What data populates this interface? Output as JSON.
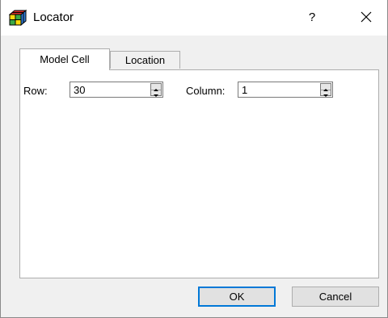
{
  "window": {
    "title": "Locator",
    "help_label": "?",
    "icons": {
      "app": "cube-app-icon",
      "close": "close-icon"
    }
  },
  "tabs": [
    {
      "label": "Model Cell",
      "selected": true
    },
    {
      "label": "Location",
      "selected": false
    }
  ],
  "fields": {
    "row": {
      "label": "Row:",
      "value": "30"
    },
    "column": {
      "label": "Column:",
      "value": "1"
    }
  },
  "buttons": {
    "ok": "OK",
    "cancel": "Cancel"
  },
  "colors": {
    "default_button_border": "#0078d7",
    "dialog_bg": "#f0f0f0"
  }
}
